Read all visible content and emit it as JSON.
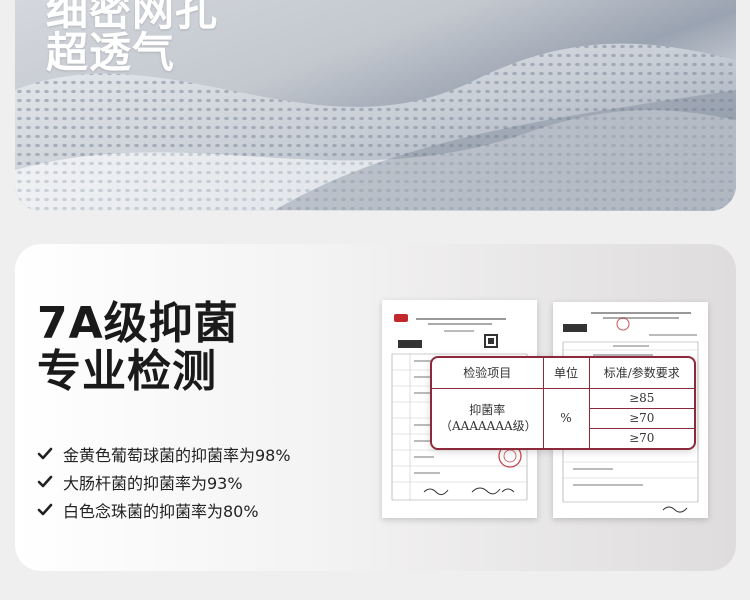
{
  "hero": {
    "title_line1": "细密网孔",
    "title_line2": "超透气"
  },
  "section": {
    "heading_line1": "7A级抑菌",
    "heading_line2": "专业检测",
    "features": [
      "金黄色葡萄球菌的抑菌率为98%",
      "大肠杆菌的抑菌率为93%",
      "白色念珠菌的抑菌率为80%"
    ]
  },
  "table": {
    "headers": [
      "检验项目",
      "单位",
      "标准/参数要求"
    ],
    "item": "抑菌率（AAAAAAA级）",
    "unit": "%",
    "values": [
      "≥85",
      "≥70",
      "≥70"
    ]
  },
  "colors": {
    "accent": "#8c2a3c",
    "stamp": "#c0282d"
  }
}
